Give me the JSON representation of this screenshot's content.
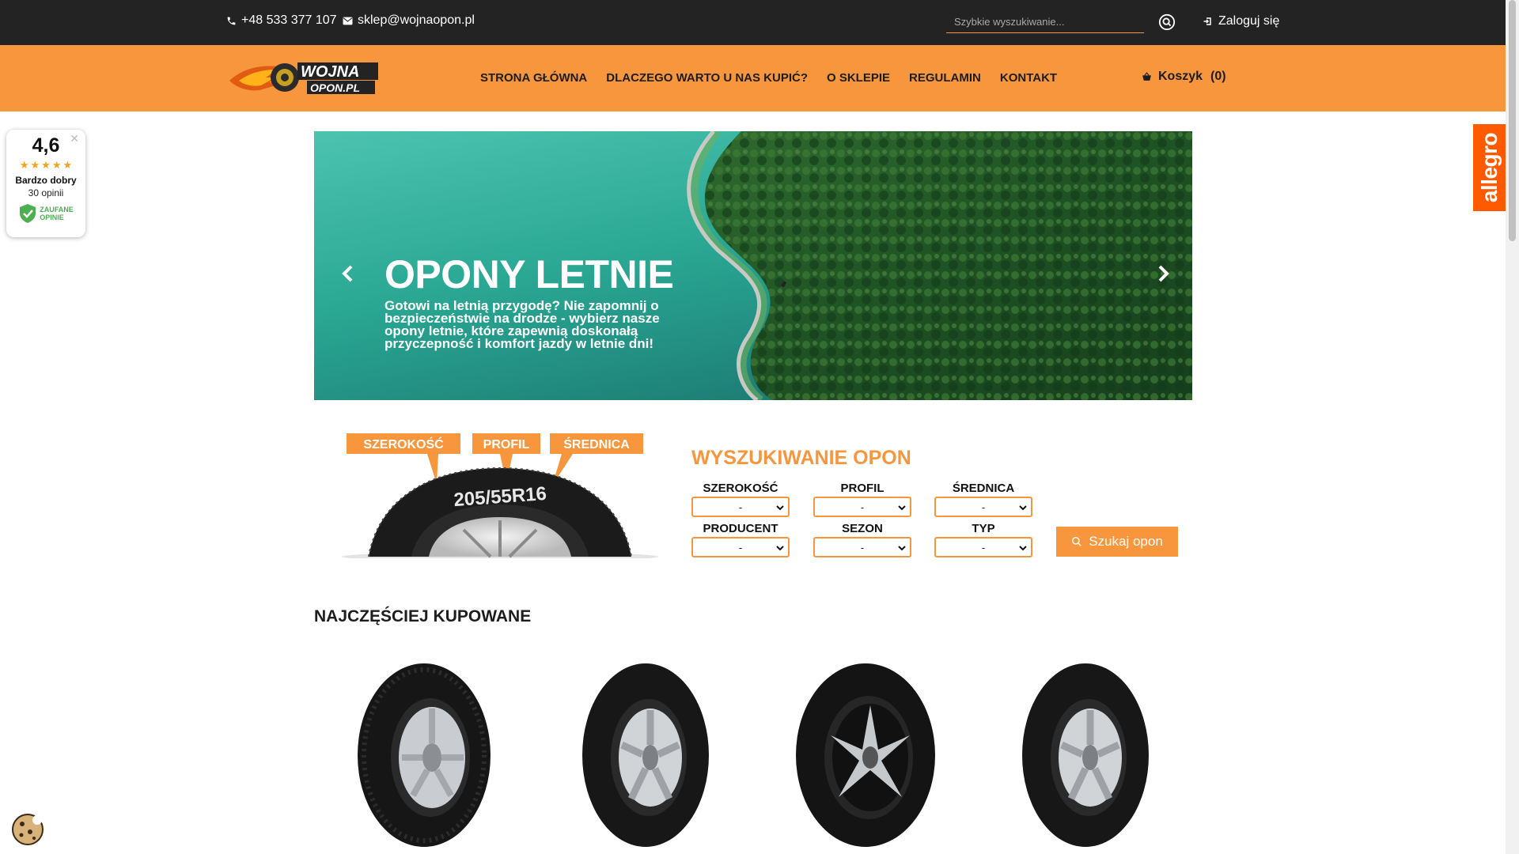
{
  "topbar": {
    "phone": "+48 533 377 107",
    "email": "sklep@wojnaopon.pl",
    "search_placeholder": "Szybkie wyszukiwanie...",
    "login_label": "Zaloguj się"
  },
  "header": {
    "logo_text_top": "WOJNA",
    "logo_text_bottom": "OPON.PL",
    "nav": [
      "STRONA GŁÓWNA",
      "DLACZEGO WARTO U NAS KUPIĆ?",
      "O SKLEPIE",
      "REGULAMIN",
      "KONTAKT"
    ],
    "cart_label": "Koszyk",
    "cart_count": "(0)"
  },
  "rating_widget": {
    "score": "4,6",
    "label": "Bardzo dobry",
    "count": "30 opinii",
    "badge_line1": "ZAUFANE",
    "badge_line2": "OPINIE",
    "stars": 5
  },
  "allegro_tab": "allegro",
  "banner": {
    "title": "OPONY LETNIE",
    "text": "Gotowi na letnią przygodę? Nie zapomnij o bezpieczeństwie na drodze - wybierz nasze opony letnie, które zapewnią doskonałą przyczepność i komfort jazdy w letnie dni!"
  },
  "tire_graphic": {
    "labels": [
      "SZEROKOŚĆ",
      "PROFIL",
      "ŚREDNICA"
    ],
    "size_text": "205/55R16"
  },
  "tire_search": {
    "title": "WYSZUKIWANIE OPON",
    "fields": [
      {
        "label": "SZEROKOŚĆ",
        "value": "-"
      },
      {
        "label": "PROFIL",
        "value": "-"
      },
      {
        "label": "ŚREDNICA",
        "value": "-"
      },
      {
        "label": "PRODUCENT",
        "value": "-"
      },
      {
        "label": "SEZON",
        "value": "-"
      },
      {
        "label": "TYP",
        "value": "-"
      }
    ],
    "button_label": "Szukaj opon"
  },
  "bestsellers": {
    "title": "NAJCZĘŚCIEJ KUPOWANE"
  },
  "colors": {
    "accent": "#f7963d",
    "topbar": "#232323",
    "allegro": "#ff5a00"
  }
}
